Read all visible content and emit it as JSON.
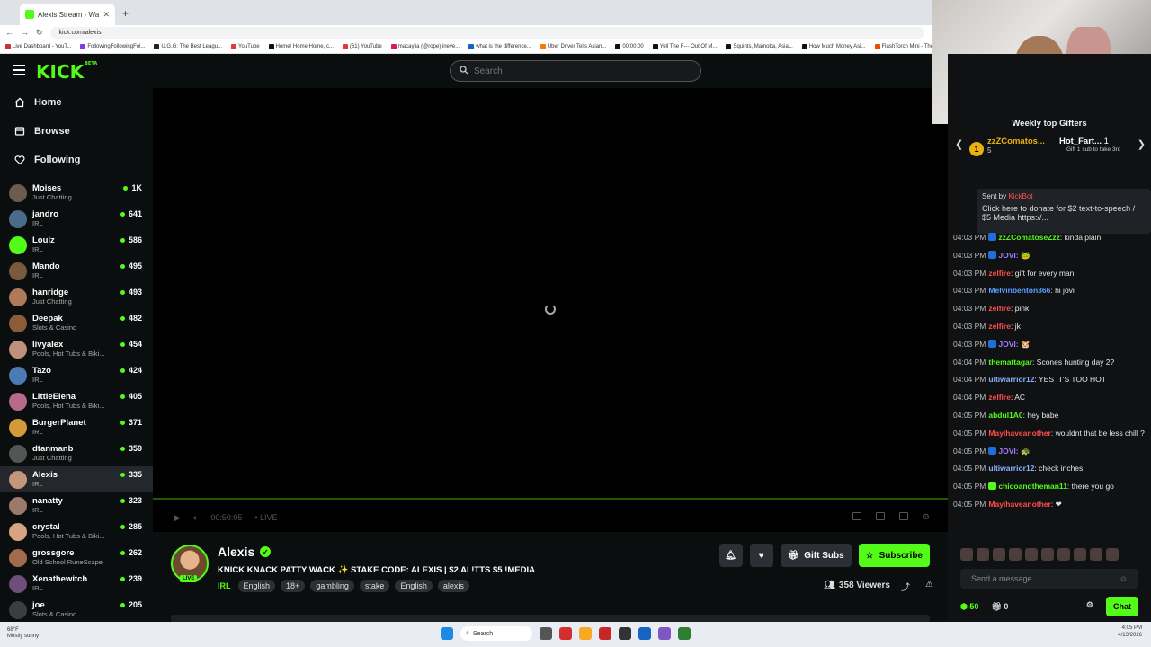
{
  "browser": {
    "tab_title": "Alexis Stream - Watch Live on K",
    "url": "kick.com/alexis",
    "bookmarks": [
      "Live Dashboard - YouT...",
      "FollowingFollowingFol...",
      "U.G.G: The Best Leagu...",
      "YouTube",
      "Home/ Home Home, c...",
      "(61) YouTube",
      "macaylia (@rope) ineve...",
      "what is the difference...",
      "Uber Driver Tells Asian...",
      "00:00:00",
      "Yell The F--- Out Of M...",
      "Squints, Mamoba, Asia...",
      "How Much Money Asi...",
      "FlashTorch Mini - The..."
    ]
  },
  "header": {
    "logo": "KICK",
    "logo_sup": "BETA",
    "search_placeholder": "Search"
  },
  "sidebar": {
    "nav": [
      {
        "label": "Home",
        "icon": "home-icon"
      },
      {
        "label": "Browse",
        "icon": "browse-icon"
      },
      {
        "label": "Following",
        "icon": "heart-icon"
      }
    ],
    "following": [
      {
        "name": "Moises",
        "category": "Just Chatting",
        "viewers": "1K",
        "color": "#6c5b4f"
      },
      {
        "name": "jandro",
        "category": "IRL",
        "viewers": "641",
        "color": "#4b6b8a"
      },
      {
        "name": "Loulz",
        "category": "IRL",
        "viewers": "586",
        "color": "#53fc18"
      },
      {
        "name": "Mando",
        "category": "IRL",
        "viewers": "495",
        "color": "#7a5a3c"
      },
      {
        "name": "hanridge",
        "category": "Just Chatting",
        "viewers": "493",
        "color": "#b07a5a"
      },
      {
        "name": "Deepak",
        "category": "Slots & Casino",
        "viewers": "482",
        "color": "#8a5c3a"
      },
      {
        "name": "livyalex",
        "category": "Pools, Hot Tubs & Biki...",
        "viewers": "454",
        "color": "#c0907a"
      },
      {
        "name": "Tazo",
        "category": "IRL",
        "viewers": "424",
        "color": "#4a7bb5"
      },
      {
        "name": "LittleElena",
        "category": "Pools, Hot Tubs & Biki...",
        "viewers": "405",
        "color": "#b86a8c"
      },
      {
        "name": "BurgerPlanet",
        "category": "IRL",
        "viewers": "371",
        "color": "#d49a3a"
      },
      {
        "name": "dtanmanb",
        "category": "Just Chatting",
        "viewers": "359",
        "color": "#555"
      },
      {
        "name": "Alexis",
        "category": "IRL",
        "viewers": "335",
        "color": "#c4967a"
      },
      {
        "name": "nanatty",
        "category": "IRL",
        "viewers": "323",
        "color": "#9c7a6a"
      },
      {
        "name": "crystal",
        "category": "Pools, Hot Tubs & Biki...",
        "viewers": "285",
        "color": "#d8a380"
      },
      {
        "name": "grossgore",
        "category": "Old School RuneScape",
        "viewers": "262",
        "color": "#a36b4e"
      },
      {
        "name": "Xenathewitch",
        "category": "IRL",
        "viewers": "239",
        "color": "#6e4f7a"
      },
      {
        "name": "joe",
        "category": "Slots & Casino",
        "viewers": "205",
        "color": "#3d3d3d"
      }
    ]
  },
  "player": {
    "time": "00:50:05",
    "live_label": "LIVE"
  },
  "stream": {
    "name": "Alexis",
    "live_badge": "LIVE",
    "title": "KNICK KNACK PATTY WACK ✨ STAKE CODE: ALEXIS | $2 AI !TTS $5 !MEDIA",
    "category": "IRL",
    "tags": [
      "English",
      "18+",
      "gambling",
      "stake",
      "English",
      "alexis"
    ],
    "gift_subs_label": "Gift Subs",
    "subscribe_label": "Subscribe",
    "viewers": "358 Viewers"
  },
  "chat": {
    "gifters_title": "Weekly top Gifters",
    "gifter1": {
      "rank": "1",
      "name": "zzZComatos...",
      "count": "5"
    },
    "gifter2": {
      "name": "Hot_Fart...",
      "count": "1",
      "hint": "Gift 1 sub to take 3rd"
    },
    "pinned": {
      "sent_by": "Sent by",
      "bot": "KickBot",
      "text": "Click here to donate for $2 text-to-speech / $5 Media https://..."
    },
    "messages": [
      {
        "time": "04:03 PM",
        "user": "zzZComatoseZzz",
        "color": "#53fc18",
        "text": ": kinda plain"
      },
      {
        "time": "04:03 PM",
        "user": "JOVI:",
        "color": "#a27bff",
        "text": " 🐸"
      },
      {
        "time": "04:03 PM",
        "user": "zelfire",
        "color": "#ff4d4d",
        "text": ": gift for every man"
      },
      {
        "time": "04:03 PM",
        "user": "Melvinbenton366",
        "color": "#5aa0ff",
        "text": ": hi jovi"
      },
      {
        "time": "04:03 PM",
        "user": "zelfire",
        "color": "#ff4d4d",
        "text": ": pink"
      },
      {
        "time": "04:03 PM",
        "user": "zelfire",
        "color": "#ff4d4d",
        "text": ": jk"
      },
      {
        "time": "04:03 PM",
        "user": "JOVI:",
        "color": "#a27bff",
        "text": " 🐹"
      },
      {
        "time": "04:04 PM",
        "user": "themattagar",
        "color": "#53fc18",
        "text": ": Scones hunting day 2?"
      },
      {
        "time": "04:04 PM",
        "user": "ultiwarrior12",
        "color": "#8ab4ff",
        "text": ": YES IT'S TOO HOT"
      },
      {
        "time": "04:04 PM",
        "user": "zelfire",
        "color": "#ff4d4d",
        "text": ": AC"
      },
      {
        "time": "04:05 PM",
        "user": "abdul1A0",
        "color": "#53fc18",
        "text": ": hey babe"
      },
      {
        "time": "04:05 PM",
        "user": "Mayihaveanother",
        "color": "#ff4d4d",
        "text": ": wouldnt that be less chill ?"
      },
      {
        "time": "04:05 PM",
        "user": "JOVI:",
        "color": "#a27bff",
        "text": " 🐢"
      },
      {
        "time": "04:05 PM",
        "user": "ultiwarrior12",
        "color": "#8ab4ff",
        "text": ": check inches"
      },
      {
        "time": "04:05 PM",
        "user": "chicoandtheman11",
        "color": "#53fc18",
        "text": ": there you go"
      },
      {
        "time": "04:05 PM",
        "user": "Mayihaveanother",
        "color": "#ff4d4d",
        "text": ": ❤"
      }
    ],
    "input_placeholder": "Send a message",
    "points": "50",
    "gifts": "0",
    "chat_button": "Chat"
  },
  "taskbar": {
    "weather": "68°F\nMostly sunny",
    "search": "Search",
    "time": "4:05 PM",
    "date": "4/13/2026"
  }
}
